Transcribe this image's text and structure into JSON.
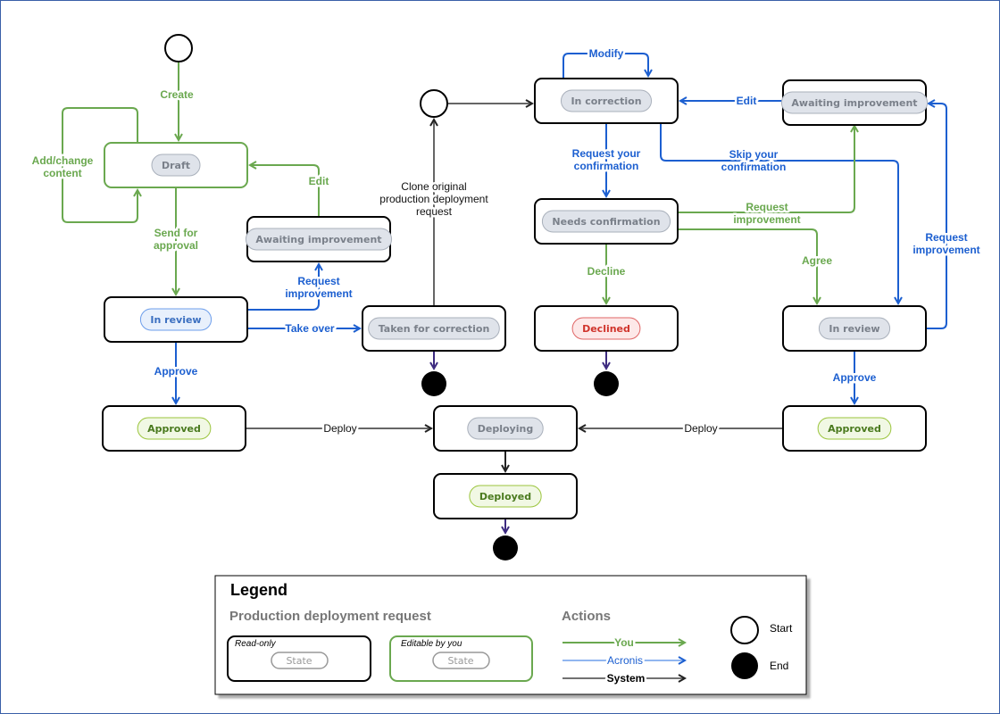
{
  "colors": {
    "you": "#6aa84f",
    "acronis": "#1c5fd0",
    "system": "#666666",
    "end_arrow": "#3d2b80"
  },
  "states": {
    "draft": "Draft",
    "awaiting_left": "Awaiting improvement",
    "in_review_left": "In review",
    "taken_for_correction": "Taken for correction",
    "approved_left": "Approved",
    "deploying": "Deploying",
    "deployed": "Deployed",
    "in_correction": "In correction",
    "awaiting_right": "Awaiting improvement",
    "needs_confirmation": "Needs confirmation",
    "declined": "Declined",
    "in_review_right": "In review",
    "approved_right": "Approved"
  },
  "actions": {
    "create": "Create",
    "add_change": [
      "Add/change",
      "content"
    ],
    "send_for_approval": [
      "Send for",
      "approval"
    ],
    "edit_left": "Edit",
    "request_improvement_left": [
      "Request",
      "improvement"
    ],
    "take_over": "Take over",
    "approve_left": "Approve",
    "deploy_left": "Deploy",
    "clone": [
      "Clone original",
      "production deployment",
      "request"
    ],
    "modify": "Modify",
    "edit_right": "Edit",
    "request_confirmation": [
      "Request your",
      "confirmation"
    ],
    "skip_confirmation": [
      "Skip your",
      "confirmation"
    ],
    "request_improvement_mid": [
      "Request",
      "improvement"
    ],
    "agree": "Agree",
    "decline": "Decline",
    "request_improvement_right": [
      "Request",
      "improvement"
    ],
    "approve_right": "Approve",
    "deploy_right": "Deploy"
  },
  "legend": {
    "title": "Legend",
    "section_request": "Production deployment request",
    "read_only": "Read-only",
    "editable": "Editable by you",
    "state": "State",
    "section_actions": "Actions",
    "you": "You",
    "acronis": "Acronis",
    "system": "System",
    "start": "Start",
    "end": "End"
  }
}
